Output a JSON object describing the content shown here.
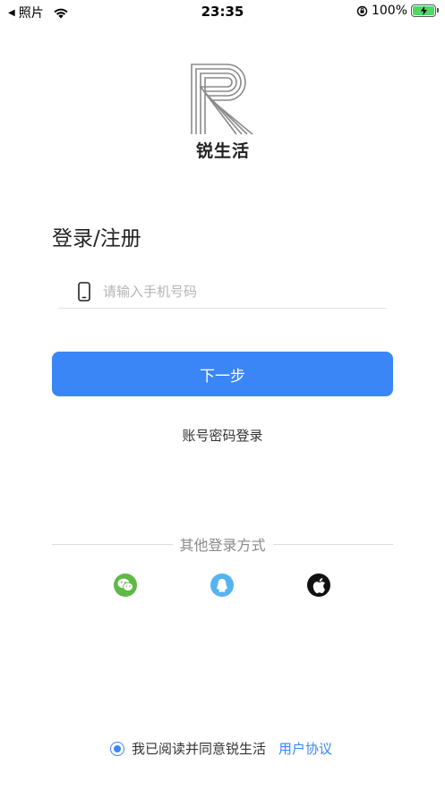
{
  "status_bar": {
    "back_label": "照片",
    "time": "23:35",
    "battery": "100%"
  },
  "logo": {
    "letter": "R",
    "brand_name": "锐生活"
  },
  "page_title": "登录/注册",
  "phone_input": {
    "placeholder": "请输入手机号码",
    "value": ""
  },
  "next_button_label": "下一步",
  "password_login_label": "账号密码登录",
  "other_login": {
    "label": "其他登录方式",
    "options": [
      "wechat-icon",
      "qq-icon",
      "apple-icon"
    ]
  },
  "agreement": {
    "text": "我已阅读并同意锐生活",
    "link": "用户协议"
  },
  "colors": {
    "accent": "#3b86f6",
    "wechat": "#60b846",
    "qq": "#55b3f0",
    "apple": "#111111"
  }
}
